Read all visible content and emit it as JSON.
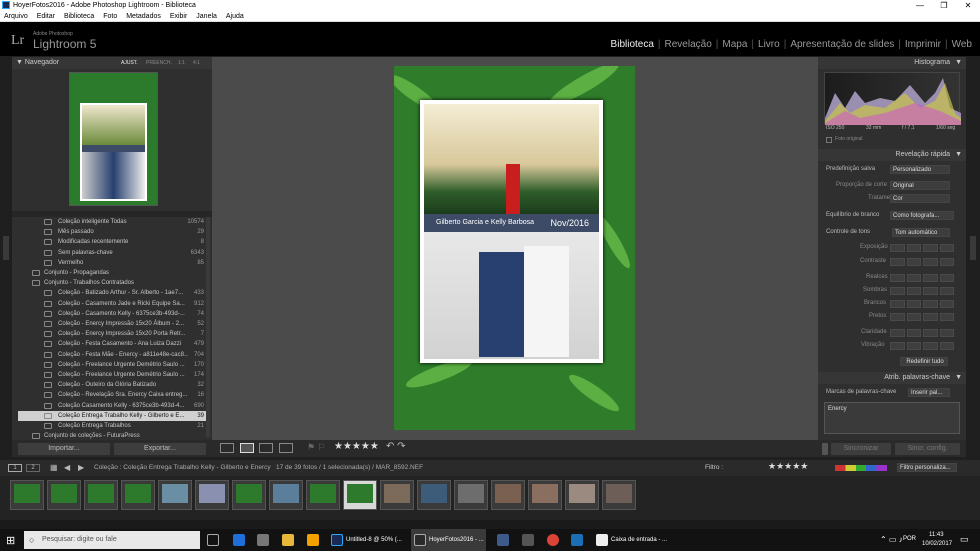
{
  "window": {
    "title": "HoyerFotos2016 - Adobe Photoshop Lightroom - Biblioteca"
  },
  "menu": [
    "Arquivo",
    "Editar",
    "Biblioteca",
    "Foto",
    "Metadados",
    "Exibir",
    "Janela",
    "Ajuda"
  ],
  "app": {
    "logo": "Lr",
    "small": "Adobe Photoshop",
    "name": "Lightroom 5"
  },
  "modules": [
    "Biblioteca",
    "Revelação",
    "Mapa",
    "Livro",
    "Apresentação de slides",
    "Imprimir",
    "Web"
  ],
  "navigator": {
    "title": "Navegador",
    "options": [
      "AJUST.",
      "PREENCH.",
      "1:1",
      "4:1"
    ]
  },
  "collections": [
    {
      "label": "Coleção inteligente Todas",
      "count": "10574",
      "indent": 2
    },
    {
      "label": "Mês passado",
      "count": "29",
      "indent": 2
    },
    {
      "label": "Modificadas recentemente",
      "count": "8",
      "indent": 2
    },
    {
      "label": "Sem palavras-chave",
      "count": "6343",
      "indent": 2
    },
    {
      "label": "Vermelho",
      "count": "85",
      "indent": 2
    },
    {
      "label": "Conjunto - Propagandas",
      "count": "",
      "indent": 1
    },
    {
      "label": "Conjunto - Trabalhos Contratados",
      "count": "",
      "indent": 1
    },
    {
      "label": "Coleção - Batizado Arthur - Sr. Alberto - 1ae7...",
      "count": "433",
      "indent": 2
    },
    {
      "label": "Coleção - Casamento Jade e Ricki Equipe Sa...",
      "count": "912",
      "indent": 2
    },
    {
      "label": "Coleção - Casamento Kelly - 6375ce3b-493d-...",
      "count": "74",
      "indent": 2
    },
    {
      "label": "Coleção - Enercy Impressão 15x20 Álbum - 2...",
      "count": "52",
      "indent": 2
    },
    {
      "label": "Coleção - Enercy Impressão 15x20 Porta Retr...",
      "count": "7",
      "indent": 2
    },
    {
      "label": "Coleção - Festa Casamento - Ana  Luiza Dazzi",
      "count": "479",
      "indent": 2
    },
    {
      "label": "Coleção - Festa Mãe - Enercy - a811e48e-cac8...",
      "count": "704",
      "indent": 2
    },
    {
      "label": "Coleção - Freelance Urgente Demétrio Saulo ...",
      "count": "170",
      "indent": 2
    },
    {
      "label": "Coleção - Freelance Urgente Demétrio Saulo ...",
      "count": "174",
      "indent": 2
    },
    {
      "label": "Coleção - Outeiro da Glória Batizado",
      "count": "32",
      "indent": 2
    },
    {
      "label": "Coleção - Revelação Sra. Enercy Caixa entreg...",
      "count": "16",
      "indent": 2
    },
    {
      "label": "Coleção Casamento Kelly - 6375ce3b-493d-4...",
      "count": "690",
      "indent": 2
    },
    {
      "label": "Coleção Entrega Trabalho Kelly - Gilberto e E...",
      "count": "39",
      "indent": 2,
      "selected": true
    },
    {
      "label": "Coleção Entrega Trabalhos",
      "count": "21",
      "indent": 2
    },
    {
      "label": "Conjunto de coleções - FuturaPress",
      "count": "",
      "indent": 1
    }
  ],
  "left_buttons": {
    "import": "Importar...",
    "export": "Exportar..."
  },
  "album": {
    "names": "Gilberto Garcia  e Kelly Barbosa",
    "date": "Nov/2016"
  },
  "histogram": {
    "title": "Histograma",
    "iso": "ISO 250",
    "focal": "32 mm",
    "aperture": "f / 7,1",
    "shutter": "1/60 seg",
    "original_label": "Foto original"
  },
  "quick_develop": {
    "title": "Revelação rápida",
    "saved_preset_label": "Predefinição salva",
    "saved_preset_value": "Personalizado",
    "crop_label": "Proporção de corte",
    "crop_value": "Original",
    "treatment_label": "Tratamento",
    "treatment_value": "Cor",
    "wb_label": "Equilíbrio de branco",
    "wb_value": "Como fotografa...",
    "tone_label": "Controle de tons",
    "tone_value": "Tom automático",
    "sliders": [
      "Exposição",
      "Contraste",
      "Realces",
      "Sombras",
      "Brancos",
      "Pretos",
      "Claridade",
      "Vibração"
    ],
    "reset": "Redefinir tudo"
  },
  "keywords": {
    "title": "Atrib. palavras-chave",
    "tags_label": "Marcas de palavras-chave",
    "tags_value": "Inserir pal...",
    "content": "Enercy"
  },
  "right_buttons": {
    "sync": "Sincronizar",
    "sync_settings": "Sincr. config."
  },
  "status": {
    "page1": "1",
    "page2": "2",
    "breadcrumb": "Coleção : Coleção Entrega Trabalho Kelly - Gilberto e Enercy",
    "count": "17 de 39 fotos / 1 selecionada(s) / MAR_8592.NEF",
    "filter_label": "Filtro :",
    "filter_value": "Filtro personaliza..."
  },
  "rating": "★★★★★",
  "taskbar": {
    "search": "Pesquisar: digite ou fale",
    "apps": [
      "Untitled-8 @ 50% (...",
      "HoyerFotos2016 - ...",
      "Caixa de entrada - ..."
    ],
    "lang": "POR",
    "time": "11:43",
    "date": "10/02/2017"
  }
}
